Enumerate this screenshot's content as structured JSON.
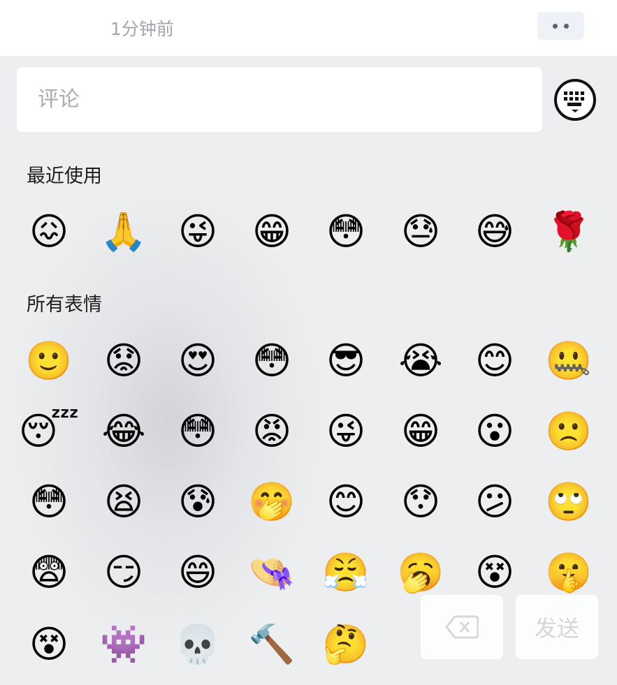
{
  "header": {
    "timestamp": "1分钟前",
    "more_icon": "more-dots-icon"
  },
  "comment": {
    "placeholder": "评论",
    "keyboard_icon": "keyboard-icon"
  },
  "sections": {
    "recent_title": "最近使用",
    "all_title": "所有表情"
  },
  "recent_emojis": [
    {
      "name": "embarrassed-emoji",
      "glyph": "😖"
    },
    {
      "name": "clap-hands-emoji",
      "glyph": "🙏"
    },
    {
      "name": "tongue-wink-emoji",
      "glyph": "😜"
    },
    {
      "name": "grin-emoji",
      "glyph": "😁"
    },
    {
      "name": "shocked-red-emoji",
      "glyph": "😳"
    },
    {
      "name": "sweat-emoji",
      "glyph": "😓"
    },
    {
      "name": "awkward-emoji",
      "glyph": "😅"
    },
    {
      "name": "rose-emoji",
      "glyph": "🌹"
    }
  ],
  "all_emojis": [
    [
      {
        "name": "smile-emoji",
        "glyph": "🙂"
      },
      {
        "name": "distressed-emoji",
        "glyph": "😟"
      },
      {
        "name": "heart-eyes-emoji",
        "glyph": "😍"
      },
      {
        "name": "stare-emoji",
        "glyph": "😳"
      },
      {
        "name": "cool-sunglasses-emoji",
        "glyph": "😎"
      },
      {
        "name": "crying-emoji",
        "glyph": "😭"
      },
      {
        "name": "shy-emoji",
        "glyph": "😊"
      },
      {
        "name": "shut-up-emoji",
        "glyph": "🤐"
      }
    ],
    [
      {
        "name": "sleep-emoji",
        "glyph": "😴"
      },
      {
        "name": "tears-of-joy-emoji",
        "glyph": "😂"
      },
      {
        "name": "embarrassed-red-emoji",
        "glyph": "😳"
      },
      {
        "name": "angry-emoji",
        "glyph": "😡"
      },
      {
        "name": "naughty-emoji",
        "glyph": "😜"
      },
      {
        "name": "big-grin-emoji",
        "glyph": "😁"
      },
      {
        "name": "surprised-emoji",
        "glyph": "😮"
      },
      {
        "name": "sad-emoji",
        "glyph": "🙁"
      }
    ],
    [
      {
        "name": "flushed-emoji",
        "glyph": "😳"
      },
      {
        "name": "yelling-emoji",
        "glyph": "😫"
      },
      {
        "name": "nervous-emoji",
        "glyph": "😰"
      },
      {
        "name": "snicker-emoji",
        "glyph": "🤭"
      },
      {
        "name": "blush-smile-emoji",
        "glyph": "😊"
      },
      {
        "name": "wow-emoji",
        "glyph": "😯"
      },
      {
        "name": "confused-emoji",
        "glyph": "😕"
      },
      {
        "name": "eye-roll-emoji",
        "glyph": "🙄"
      }
    ],
    [
      {
        "name": "scared-red-emoji",
        "glyph": "😨"
      },
      {
        "name": "smug-emoji",
        "glyph": "😏"
      },
      {
        "name": "happy-emoji",
        "glyph": "😄"
      },
      {
        "name": "green-hat-emoji",
        "glyph": "👒"
      },
      {
        "name": "determined-emoji",
        "glyph": "😤"
      },
      {
        "name": "yawn-emoji",
        "glyph": "🥱"
      },
      {
        "name": "question-emoji",
        "glyph": "😵"
      },
      {
        "name": "shush-emoji",
        "glyph": "🤫"
      }
    ],
    [
      {
        "name": "dizzy-emoji",
        "glyph": "😵"
      },
      {
        "name": "black-creature-emoji",
        "glyph": "👾"
      },
      {
        "name": "skull-emoji",
        "glyph": "💀"
      },
      {
        "name": "hammer-emoji",
        "glyph": "🔨"
      },
      {
        "name": "thinking-emoji",
        "glyph": "🤔"
      }
    ]
  ],
  "actions": {
    "backspace_icon": "backspace-icon",
    "send_label": "发送"
  }
}
